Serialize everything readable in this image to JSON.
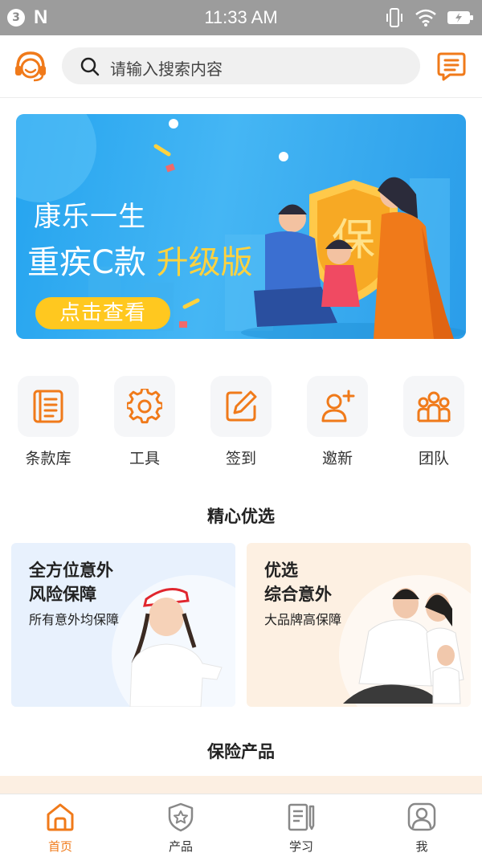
{
  "status_bar": {
    "notification_count": "3",
    "app_letter": "N",
    "time": "11:33 AM"
  },
  "header": {
    "search_placeholder": "请输入搜索内容"
  },
  "banner": {
    "line1": "康乐一生",
    "line2_main": "重疾C款",
    "line2_highlight": "升级版",
    "shield_char": "保",
    "cta": "点击查看"
  },
  "quick_menu": [
    {
      "label": "条款库",
      "icon": "clause-book-icon"
    },
    {
      "label": "工具",
      "icon": "gear-icon"
    },
    {
      "label": "签到",
      "icon": "edit-pen-icon"
    },
    {
      "label": "邀新",
      "icon": "invite-user-icon"
    },
    {
      "label": "团队",
      "icon": "team-icon"
    }
  ],
  "sections": {
    "featured_title": "精心优选",
    "products_title": "保险产品"
  },
  "featured_cards": [
    {
      "title_line1": "全方位意外",
      "title_line2": "风险保障",
      "subtitle": "所有意外均保障"
    },
    {
      "title_line1": "优选",
      "title_line2": "综合意外",
      "subtitle": "大品牌高保障"
    }
  ],
  "tab_bar": [
    {
      "label": "首页",
      "icon": "home-icon",
      "active": true
    },
    {
      "label": "产品",
      "icon": "shield-star-icon",
      "active": false
    },
    {
      "label": "学习",
      "icon": "study-notebook-icon",
      "active": false
    },
    {
      "label": "我",
      "icon": "profile-icon",
      "active": false
    }
  ],
  "colors": {
    "accent": "#f07a1a",
    "status_bar": "#9c9c9c",
    "banner_blue": "#2ea6f0",
    "banner_highlight": "#ffd23e",
    "cta_yellow": "#ffc81f"
  }
}
